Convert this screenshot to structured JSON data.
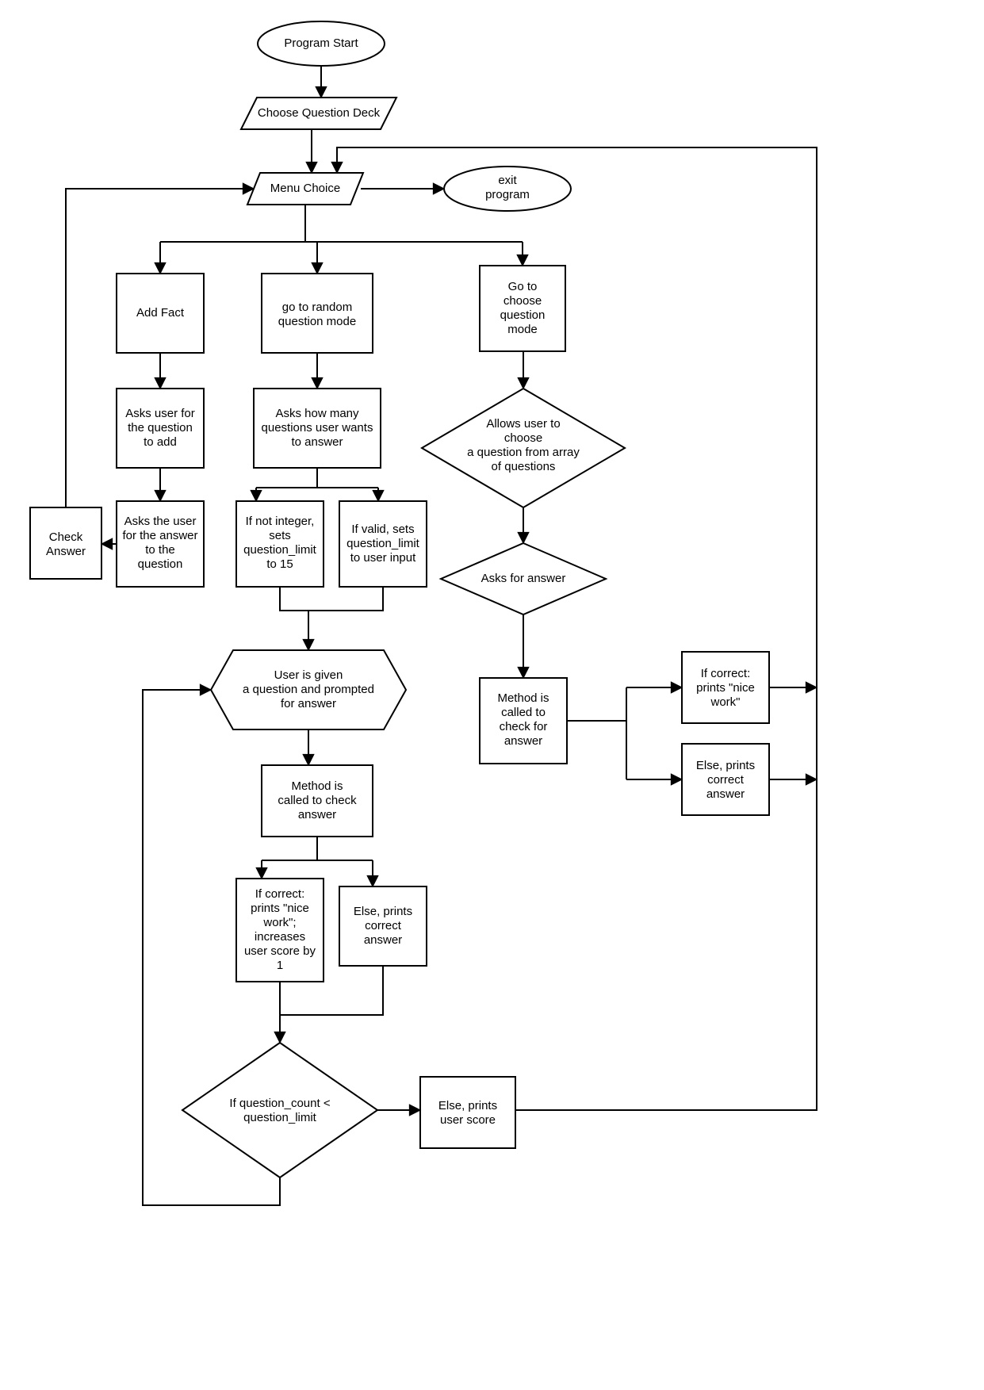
{
  "nodes": {
    "start": "Program Start",
    "chooseDeck": "Choose Question Deck",
    "menu": "Menu Choice",
    "exit": [
      "exit",
      "program"
    ],
    "addFact": "Add Fact",
    "randomMode": [
      "go to random",
      "question mode"
    ],
    "chooseMode": [
      "Go to",
      "choose",
      "question",
      "mode"
    ],
    "askQ": [
      "Asks user for",
      "the question",
      "to add"
    ],
    "askA": [
      "Asks the user",
      "for the answer",
      "to the",
      "question"
    ],
    "checkAnswer": [
      "Check",
      "Answer"
    ],
    "askHowMany": [
      "Asks how many",
      "questions user wants",
      "to answer"
    ],
    "notInt": [
      "If not integer,",
      "sets",
      "question_limit",
      "to 15"
    ],
    "valid": [
      "If valid, sets",
      "question_limit",
      "to user input"
    ],
    "allowChoose": [
      "Allows user to",
      "choose",
      "a question from array",
      "of questions"
    ],
    "asksForAnswer": "Asks for answer",
    "methodChoose": [
      "Method is",
      "called to",
      "check for",
      "answer"
    ],
    "ifCorrectChoose": [
      "If correct:",
      "prints \"nice",
      "work\""
    ],
    "elseChoose": [
      "Else, prints",
      "correct",
      "answer"
    ],
    "userPrompt": [
      "User is given",
      "a question and prompted",
      "for answer"
    ],
    "methodRandom": [
      "Method is",
      "called to check",
      "answer"
    ],
    "ifCorrectRandom": [
      "If correct:",
      "prints \"nice",
      "work\";",
      "increases",
      "user score by",
      "1"
    ],
    "elseRandom": [
      "Else, prints",
      "correct",
      "answer"
    ],
    "ifCount": [
      "If question_count <",
      "question_limit"
    ],
    "elseScore": [
      "Else, prints",
      "user score"
    ]
  }
}
